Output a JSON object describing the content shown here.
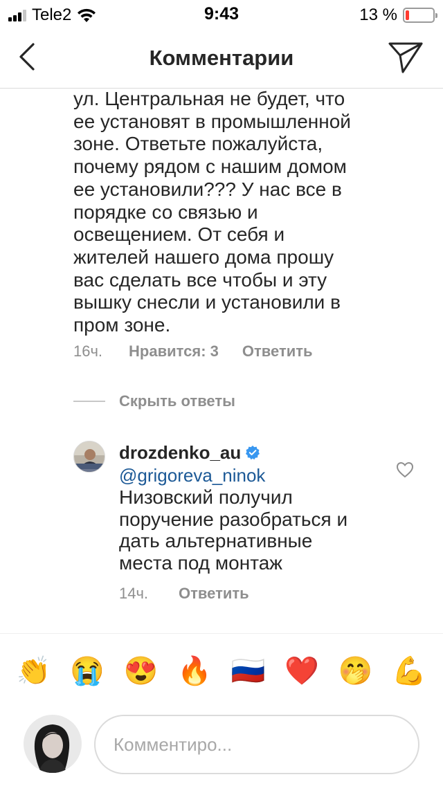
{
  "status_bar": {
    "carrier": "Tele2",
    "time": "9:43",
    "battery_percent": "13 %",
    "battery_level": 0.13,
    "signal_bars_filled": 3,
    "signal_bars_total": 4,
    "colors": {
      "battery_low": "#ff3b30"
    }
  },
  "nav": {
    "title": "Комментарии",
    "back_icon": "chevron-left-icon",
    "send_icon": "direct-send-icon"
  },
  "comment": {
    "lines": [
      "ул. Центральная не будет, что",
      "ее установят в промышленной",
      "зоне. Ответьте пожалуйста,",
      "почему рядом с нашим домом",
      "ее установили??? У нас все в",
      "порядке со связью и",
      "освещением. От себя и",
      "жителей нашего дома прошу",
      "вас сделать все чтобы и эту",
      "вышку снесли и установили в",
      "пром зоне."
    ],
    "time": "16ч.",
    "likes": "Нравится: 3",
    "reply_label": "Ответить"
  },
  "replies": {
    "hide_label": "Скрыть ответы",
    "items": [
      {
        "username": "drozdenko_au",
        "verified": true,
        "mention": "@grigoreva_ninok",
        "lines": [
          "Низовский получил",
          "поручение разобраться и",
          "дать альтернативные",
          "места под монтаж"
        ],
        "time": "14ч.",
        "reply_label": "Ответить"
      }
    ]
  },
  "emoji_bar": [
    "👏",
    "😭",
    "😍",
    "🔥",
    "🇷🇺",
    "❤️",
    "🤭",
    "💪"
  ],
  "composer": {
    "placeholder": "Комментиро..."
  },
  "colors": {
    "text": "#262626",
    "secondary": "#8e8e8e",
    "mention": "#1c5996",
    "verified": "#3897f0",
    "divider": "#dbdbdb"
  }
}
